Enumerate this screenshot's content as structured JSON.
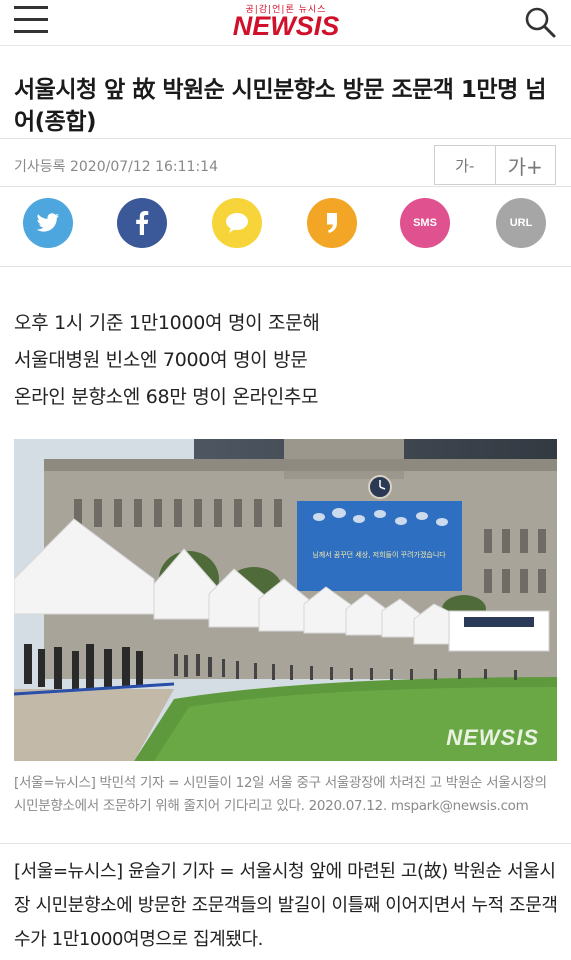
{
  "header": {
    "logo_sub": "공|감|언|론 뉴시스",
    "logo_main": "NEWSIS"
  },
  "article": {
    "title": "서울시청 앞 故 박원순 시민분향소 방문 조문객 1만명 넘어(종합)",
    "date": "기사등록  2020/07/12  16:11:14",
    "font_smaller": "가-",
    "font_larger": "가+",
    "subheads": [
      "오후 1시 기준 1만1000여 명이 조문해",
      "서울대병원 빈소엔 7000여 명이 방문",
      "온라인 분향소엔 68만 명이 온라인추모"
    ],
    "photo_watermark": "NEWSIS",
    "photo_banner_text": "님께서 꿈꾸던 세상, 저희들이 꾸려가겠습니다",
    "caption": "[서울=뉴시스] 박민석 기자 = 시민들이 12일 서울 중구 서울광장에 차려진 고 박원순 서울시장의 시민분향소에서 조문하기 위해 줄지어 기다리고 있다. 2020.07.12. mspark@newsis.com",
    "body": "[서울=뉴시스] 윤슬기 기자 = 서울시청 앞에 마련된 고(故) 박원순 서울시장 시민분향소에 방문한 조문객들의 발길이 이틀째 이어지면서 누적 조문객수가 1만1000여명으로 집계됐다."
  },
  "share": {
    "twitter_icon": "twitter-icon",
    "facebook_icon": "facebook-icon",
    "kakaotalk_icon": "kakaotalk-icon",
    "kakaostory_icon": "kakaostory-icon",
    "sms_label": "SMS",
    "url_label": "URL"
  },
  "colors": {
    "brand_red": "#d0112b",
    "twitter": "#4da7de",
    "facebook": "#3b5998",
    "kakaotalk": "#f7d43a",
    "kakaostory": "#f3a625",
    "sms": "#e0528f",
    "url": "#a6a6a6"
  }
}
